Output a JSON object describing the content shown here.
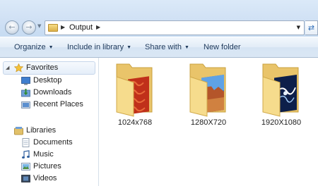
{
  "address": {
    "path": [
      "Output"
    ]
  },
  "toolbar": {
    "organize_label": "Organize",
    "include_label": "Include in library",
    "share_label": "Share with",
    "new_folder_label": "New folder"
  },
  "sidebar": {
    "favorites": {
      "label": "Favorites",
      "items": [
        {
          "label": "Desktop",
          "icon": "desktop-icon"
        },
        {
          "label": "Downloads",
          "icon": "downloads-icon"
        },
        {
          "label": "Recent Places",
          "icon": "recent-places-icon"
        }
      ]
    },
    "libraries": {
      "label": "Libraries",
      "items": [
        {
          "label": "Documents",
          "icon": "documents-icon"
        },
        {
          "label": "Music",
          "icon": "music-icon"
        },
        {
          "label": "Pictures",
          "icon": "pictures-icon"
        },
        {
          "label": "Videos",
          "icon": "videos-icon"
        }
      ]
    }
  },
  "folders": [
    {
      "name": "1024x768",
      "preview": "red-texture"
    },
    {
      "name": "1280X720",
      "preview": "desert-landscape"
    },
    {
      "name": "1920X1080",
      "preview": "blue-abstract"
    }
  ],
  "colors": {
    "chrome_blue": "#dbe9f8",
    "text_dark_blue": "#1e395b",
    "folder_yellow": "#f3d27a"
  }
}
